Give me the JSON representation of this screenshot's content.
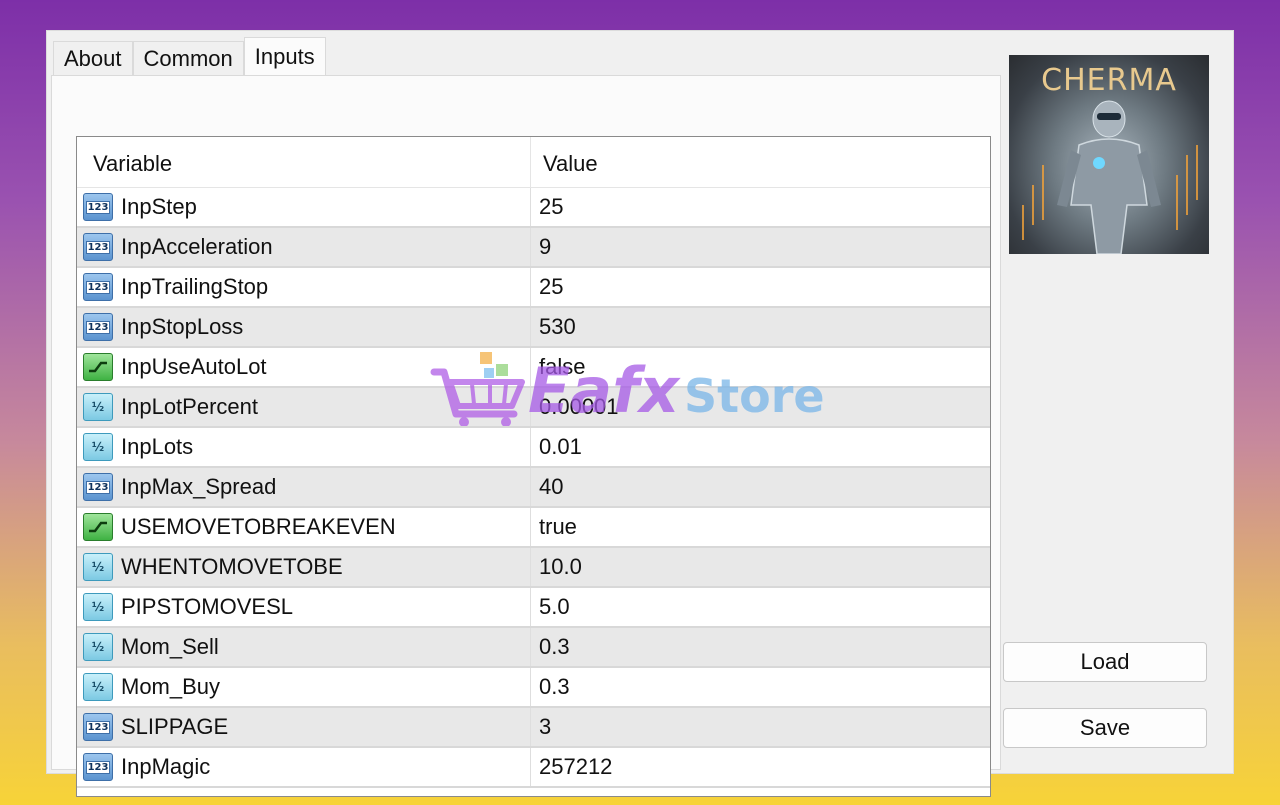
{
  "tabs": [
    {
      "label": "About"
    },
    {
      "label": "Common"
    },
    {
      "label": "Inputs",
      "active": true
    }
  ],
  "grid": {
    "columns": [
      "Variable",
      "Value"
    ],
    "rows": [
      {
        "type": "int",
        "name": "InpStep",
        "value": "25"
      },
      {
        "type": "int",
        "name": "InpAcceleration",
        "value": "9"
      },
      {
        "type": "int",
        "name": "InpTrailingStop",
        "value": "25"
      },
      {
        "type": "int",
        "name": "InpStopLoss",
        "value": "530"
      },
      {
        "type": "bool",
        "name": "InpUseAutoLot",
        "value": "false"
      },
      {
        "type": "double",
        "name": "InpLotPercent",
        "value": "0.00001"
      },
      {
        "type": "double",
        "name": "InpLots",
        "value": "0.01"
      },
      {
        "type": "int",
        "name": "InpMax_Spread",
        "value": "40"
      },
      {
        "type": "bool",
        "name": "USEMOVETOBREAKEVEN",
        "value": "true"
      },
      {
        "type": "double",
        "name": "WHENTOMOVETOBE",
        "value": "10.0"
      },
      {
        "type": "double",
        "name": "PIPSTOMOVESL",
        "value": "5.0"
      },
      {
        "type": "double",
        "name": "Mom_Sell",
        "value": "0.3"
      },
      {
        "type": "double",
        "name": "Mom_Buy",
        "value": "0.3"
      },
      {
        "type": "int",
        "name": "SLIPPAGE",
        "value": "3"
      },
      {
        "type": "int",
        "name": "InpMagic",
        "value": "257212"
      }
    ]
  },
  "icons": {
    "int": "integer-type-icon",
    "double": "double-type-icon",
    "bool": "boolean-type-icon"
  },
  "icon_glyphs": {
    "int": "123",
    "double": "½",
    "bool": ""
  },
  "logo": {
    "text": "CHERMA"
  },
  "buttons": {
    "load": "Load",
    "save": "Save"
  },
  "watermark": {
    "brand": "Eafx",
    "suffix": "Store"
  }
}
